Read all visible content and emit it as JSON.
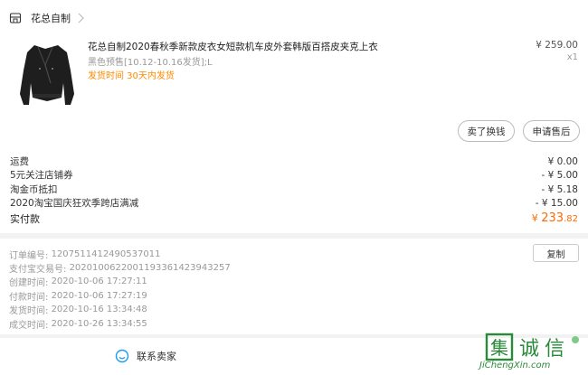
{
  "shop": {
    "name": "花总自制"
  },
  "product": {
    "title": "花总自制2020春秋季新款皮衣女短款机车皮外套韩版百搭皮夹克上衣",
    "spec": "黑色预售[10.12-10.16发货];L",
    "ship_note": "发货时间 30天内发货",
    "price": "¥ 259.00",
    "qty": "x1"
  },
  "actions": {
    "sell_label": "卖了换钱",
    "after_sale_label": "申请售后"
  },
  "fees": [
    {
      "label": "运费",
      "value": "¥ 0.00"
    },
    {
      "label": "5元关注店铺券",
      "value": "- ¥ 5.00"
    },
    {
      "label": "淘金币抵扣",
      "value": "- ¥ 5.18"
    },
    {
      "label": "2020淘宝国庆狂欢季跨店满减",
      "value": "- ¥ 15.00"
    }
  ],
  "total": {
    "label": "实付款",
    "currency": "¥",
    "int": "233",
    "dec": ".82"
  },
  "order_info": {
    "copy_label": "复制",
    "lines": [
      {
        "label": "订单编号:",
        "value": "1207511412490537011"
      },
      {
        "label": "支付宝交易号:",
        "value": "2020100622001193361423943257"
      },
      {
        "label": "创建时间:",
        "value": "2020-10-06 17:27:11"
      },
      {
        "label": "付款时间:",
        "value": "2020-10-06 17:27:19"
      },
      {
        "label": "发货时间:",
        "value": "2020-10-16 13:34:48"
      },
      {
        "label": "成交时间:",
        "value": "2020-10-26 13:34:55"
      }
    ]
  },
  "contact": {
    "label": "联系卖家"
  },
  "watermark": {
    "text": "集诚信",
    "url": "JiChengXin.com"
  },
  "colors": {
    "accent": "#ff6a00",
    "ship_note": "#ff8a00",
    "contact_icon": "#1a9bf0"
  }
}
